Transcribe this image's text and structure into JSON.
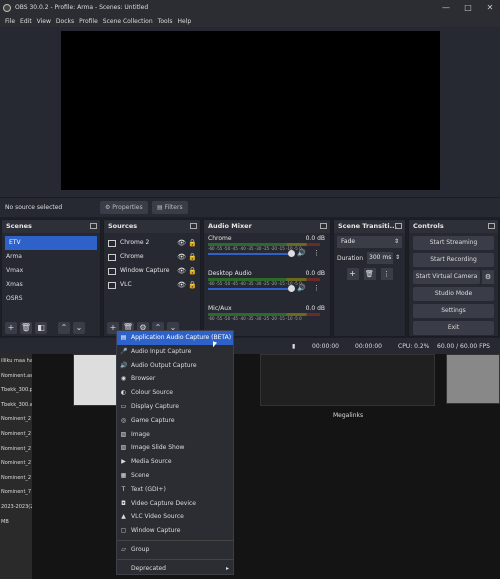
{
  "window": {
    "title": "OBS 30.0.2 - Profile: Arma - Scenes: Untitled"
  },
  "menubar": [
    "File",
    "Edit",
    "View",
    "Docks",
    "Profile",
    "Scene Collection",
    "Tools",
    "Help"
  ],
  "srcbar": {
    "no_source": "No source selected",
    "properties": "Properties",
    "filters": "Filters"
  },
  "scenes": {
    "title": "Scenes",
    "items": [
      "ETV",
      "Arma",
      "Vmax",
      "Xmas",
      "OSRS"
    ]
  },
  "sources": {
    "title": "Sources",
    "items": [
      "Chrome 2",
      "Chrome",
      "Window Capture",
      "VLC"
    ]
  },
  "audio": {
    "title": "Audio Mixer",
    "channels": [
      {
        "name": "Chrome",
        "db": "0.0 dB"
      },
      {
        "name": "Desktop Audio",
        "db": "0.0 dB"
      },
      {
        "name": "Mic/Aux",
        "db": "0.0 dB"
      }
    ],
    "ticks": "-60 -55 -50 -45 -40 -35 -30 -25 -20 -15 -10 -5 0"
  },
  "transitions": {
    "title": "Scene Transiti...",
    "type": "Fade",
    "duration_label": "Duration",
    "duration": "300 ms"
  },
  "controls": {
    "title": "Controls",
    "buttons": [
      "Start Streaming",
      "Start Recording",
      "Start Virtual Camera",
      "Studio Mode",
      "Settings",
      "Exit"
    ]
  },
  "status": {
    "time1": "00:00:00",
    "time2": "00:00:00",
    "cpu": "CPU: 0.2%",
    "fps": "60.00 / 60.00 FPS"
  },
  "context_menu": {
    "items": [
      "Application Audio Capture (BETA)",
      "Audio Input Capture",
      "Audio Output Capture",
      "Browser",
      "Colour Source",
      "Display Capture",
      "Game Capture",
      "Image",
      "Image Slide Show",
      "Media Source",
      "Scene",
      "Text (GDI+)",
      "Video Capture Device",
      "VLC Video Source",
      "Window Capture"
    ],
    "group": "Group",
    "deprecated": "Deprecated"
  },
  "desktop": {
    "files": [
      "illiku maa ha",
      "Nominent.as",
      "Tbekk_300.pd",
      "Tbekk_300.ai",
      "Nominent_2",
      "Nominent_2",
      "Nominent_2",
      "Nominent_2",
      "Nominent_2",
      "Nominent_7",
      "2023-2023(2",
      "MB"
    ],
    "thumb_caption": "Megalinks"
  }
}
